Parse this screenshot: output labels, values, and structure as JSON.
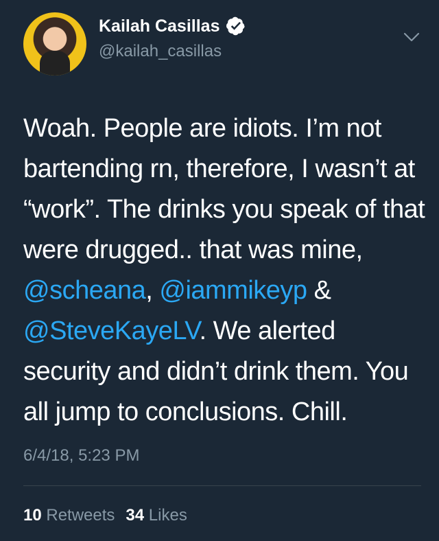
{
  "user": {
    "display_name": "Kailah Casillas",
    "handle": "@kailah_casillas"
  },
  "tweet": {
    "text_parts": [
      "Woah. People are idiots. I’m not bartending rn, therefore, I wasn’t at “work”. The drinks you speak of that were drugged.. that was mine, ",
      "@scheana",
      ", ",
      "@iammikeyp",
      " & ",
      "@SteveKayeLV",
      ". We alerted security and didn’t drink them. You all jump to conclusions. Chill."
    ],
    "timestamp": "6/4/18, 5:23 PM"
  },
  "stats": {
    "retweets_count": "10",
    "retweets_label": "Retweets",
    "likes_count": "34",
    "likes_label": "Likes"
  },
  "colors": {
    "background": "#1b2836",
    "link": "#2ba8f4",
    "muted": "#8899a6",
    "divider": "#38444d"
  },
  "icons": {
    "verified": "verified-badge-icon",
    "menu": "chevron-down-icon"
  }
}
